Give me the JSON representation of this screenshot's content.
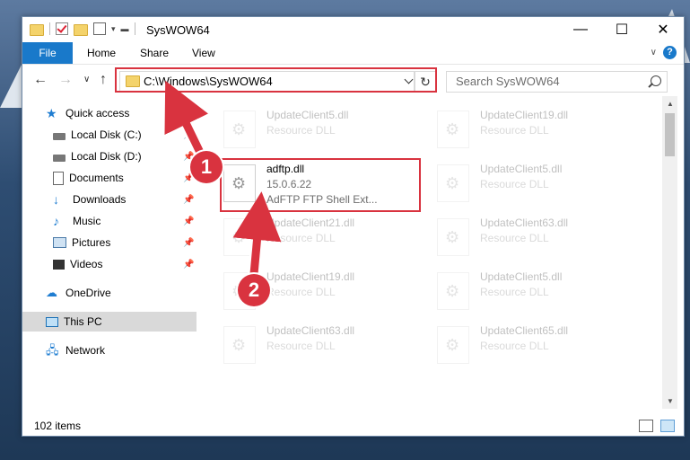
{
  "window": {
    "title": "SysWOW64",
    "controls": {
      "minimize": "—",
      "maximize": "☐",
      "close": "✕"
    }
  },
  "ribbon": {
    "tabs": [
      "File",
      "Home",
      "Share",
      "View"
    ],
    "help": "?"
  },
  "address": {
    "path": "C:\\Windows\\SysWOW64",
    "search_placeholder": "Search SysWOW64"
  },
  "sidebar": {
    "items": [
      {
        "label": "Quick access",
        "icon": "star-icon"
      },
      {
        "label": "Local Disk (C:)",
        "icon": "disk-icon",
        "pinned": true
      },
      {
        "label": "Local Disk (D:)",
        "icon": "disk-icon",
        "pinned": true
      },
      {
        "label": "Documents",
        "icon": "documents-icon",
        "pinned": true
      },
      {
        "label": "Downloads",
        "icon": "downloads-icon",
        "pinned": true
      },
      {
        "label": "Music",
        "icon": "music-icon",
        "pinned": true
      },
      {
        "label": "Pictures",
        "icon": "pictures-icon",
        "pinned": true
      },
      {
        "label": "Videos",
        "icon": "videos-icon",
        "pinned": true
      },
      {
        "label": "OneDrive",
        "icon": "cloud-icon"
      },
      {
        "label": "This PC",
        "icon": "pc-icon",
        "selected": true
      },
      {
        "label": "Network",
        "icon": "network-icon"
      }
    ]
  },
  "files": {
    "col1": [
      {
        "name": "UpdateClient5.dll",
        "type": "Resource DLL"
      },
      {
        "name": "adftp.dll",
        "version": "15.0.6.22",
        "desc": "AdFTP FTP Shell Ext..."
      },
      {
        "name": "UpdateClient21.dll",
        "type": "Resource DLL"
      },
      {
        "name": "UpdateClient19.dll",
        "type": "Resource DLL"
      },
      {
        "name": "UpdateClient63.dll",
        "type": "Resource DLL"
      }
    ],
    "col2": [
      {
        "name": "UpdateClient19.dll",
        "type": "Resource DLL"
      },
      {
        "name": "UpdateClient5.dll",
        "type": "Resource DLL"
      },
      {
        "name": "UpdateClient63.dll",
        "type": "Resource DLL"
      },
      {
        "name": "UpdateClient5.dll",
        "type": "Resource DLL"
      },
      {
        "name": "UpdateClient65.dll",
        "type": "Resource DLL"
      }
    ]
  },
  "status": {
    "count": "102 items"
  },
  "callouts": [
    "1",
    "2"
  ],
  "colors": {
    "accent": "#1979ca",
    "callout": "#d9333f"
  }
}
